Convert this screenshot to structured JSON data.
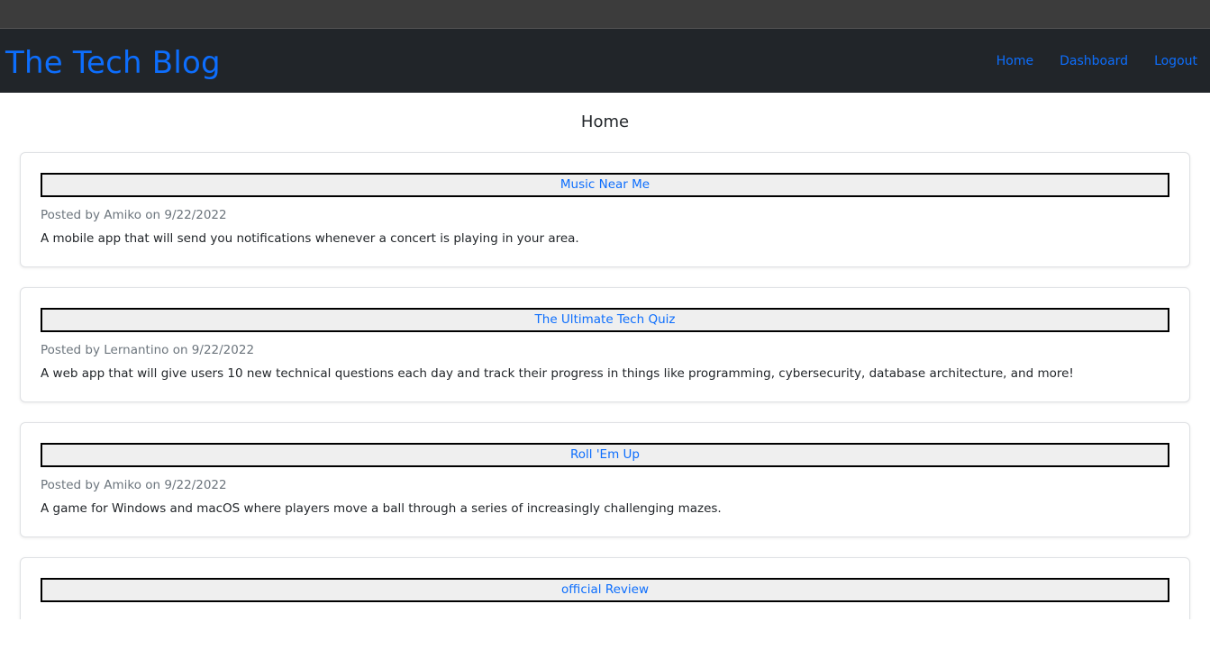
{
  "header": {
    "brand": "The Tech Blog",
    "nav": [
      {
        "label": "Home"
      },
      {
        "label": "Dashboard"
      },
      {
        "label": "Logout"
      }
    ]
  },
  "main": {
    "heading": "Home",
    "posts": [
      {
        "title": "Music Near Me",
        "meta": "Posted by Amiko on 9/22/2022",
        "body": "A mobile app that will send you notifications whenever a concert is playing in your area."
      },
      {
        "title": "The Ultimate Tech Quiz",
        "meta": "Posted by Lernantino on 9/22/2022",
        "body": "A web app that will give users 10 new technical questions each day and track their progress in things like programming, cybersecurity, database architecture, and more!"
      },
      {
        "title": "Roll 'Em Up",
        "meta": "Posted by Amiko on 9/22/2022",
        "body": "A game for Windows and macOS where players move a ball through a series of increasingly challenging mazes."
      },
      {
        "title": "official Review",
        "meta": "",
        "body": ""
      }
    ]
  },
  "colors": {
    "navbar_bg": "#212529",
    "link": "#0d6efd",
    "meta_text": "#6c757d"
  }
}
